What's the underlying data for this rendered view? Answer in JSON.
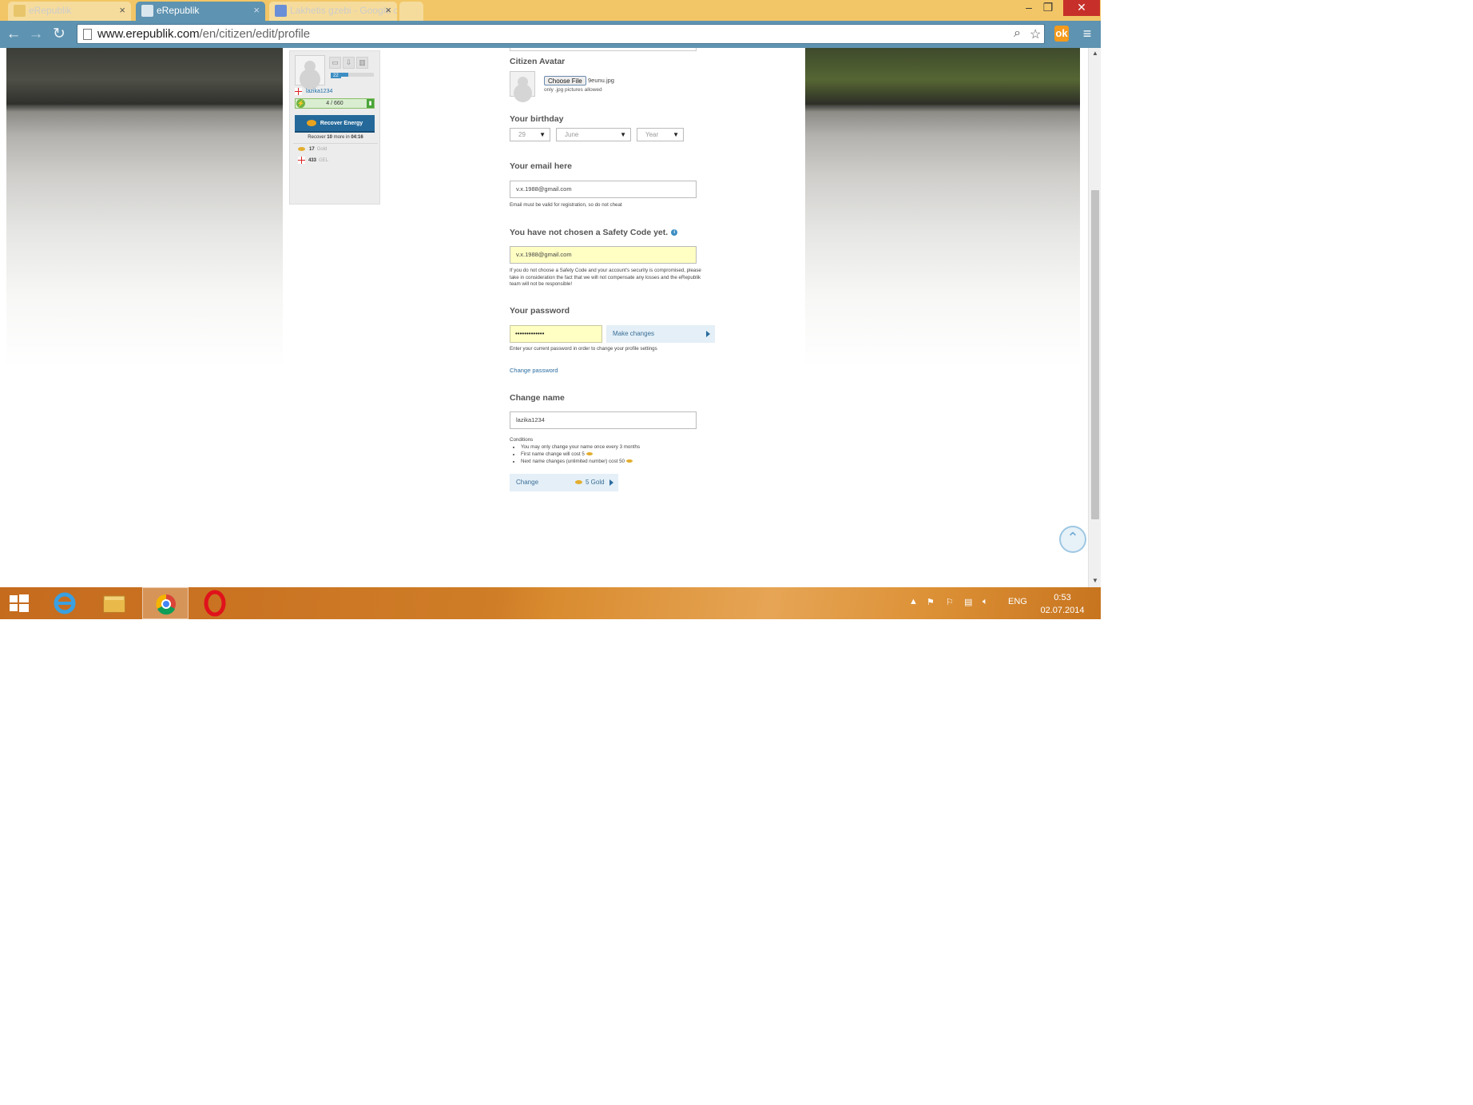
{
  "browser": {
    "tabs": [
      {
        "title": "eRepublik",
        "state": "inactive"
      },
      {
        "title": "eRepublik",
        "state": "active"
      },
      {
        "title": "Lakhetis gzebi - Google c",
        "state": "inactive"
      }
    ],
    "url_host": "www.erepublik.com",
    "url_path": "/en/citizen/edit/profile",
    "window_controls": {
      "minimize": "–",
      "restore": "❐",
      "close": "✕"
    }
  },
  "sidebar": {
    "level": "22",
    "username": "lazika1234",
    "energy": "4 / 660",
    "recover_button": "Recover Energy",
    "recover_text_pre": "Recover",
    "recover_amount": "10",
    "recover_text_mid": "more in",
    "recover_time": "04:16",
    "gold_amount": "17",
    "gold_unit": "Gold",
    "gel_amount": "433",
    "gel_unit": "GEL"
  },
  "form": {
    "avatar": {
      "label": "Citizen Avatar",
      "choose_button": "Choose File",
      "file_name": "9eunu.jpg",
      "hint": "only .jpg pictures allowed"
    },
    "birthday": {
      "label": "Your birthday",
      "day": "29",
      "month": "June",
      "year": "Year"
    },
    "email": {
      "label": "Your email here",
      "value": "v.x.1988@gmail.com",
      "note": "Email must be valid for registration, so do not cheat"
    },
    "safety": {
      "label": "You have not chosen a Safety Code yet.",
      "value": "v.x.1988@gmail.com",
      "note": "If you do not choose a Safety Code and your account's security is compromised, please take in consideration the fact that we will not compensate any losses and the eRepublik team will not be responsible!"
    },
    "password": {
      "label": "Your password",
      "value": "•••••••••••••",
      "make_changes": "Make changes",
      "note": "Enter your current password in order to change your profile settings",
      "change_link": "Change password"
    },
    "change_name": {
      "label": "Change name",
      "value": "lazika1234",
      "conditions_title": "Conditions",
      "conditions": [
        "You may only change your name once every 3 months",
        "First name change will cost 5",
        "Next name changes (unlimited number) cost 50"
      ],
      "button": "Change",
      "cost": "5 Gold"
    }
  },
  "taskbar": {
    "language": "ENG",
    "time": "0:53",
    "date": "02.07.2014"
  },
  "colors": {
    "browser_chrome": "#5e93b1",
    "tabbar": "#f2c666",
    "taskbar": "#d98b2f",
    "link": "#2a6ca0",
    "highlight_input": "#ffffc4"
  }
}
